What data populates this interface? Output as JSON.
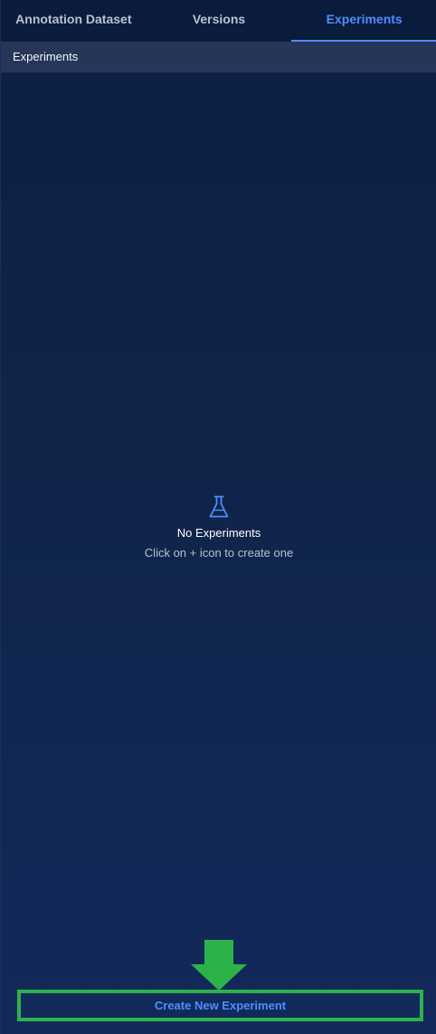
{
  "tabs": [
    {
      "label": "Annotation Dataset",
      "active": false
    },
    {
      "label": "Versions",
      "active": false
    },
    {
      "label": "Experiments",
      "active": true
    }
  ],
  "section": {
    "title": "Experiments"
  },
  "empty_state": {
    "icon": "flask-icon",
    "title": "No Experiments",
    "subtitle": "Click on + icon to create one"
  },
  "actions": {
    "create_label": "Create New Experiment"
  },
  "colors": {
    "accent": "#4f8dff",
    "highlight": "#2bb34a",
    "background": "#10244a"
  }
}
